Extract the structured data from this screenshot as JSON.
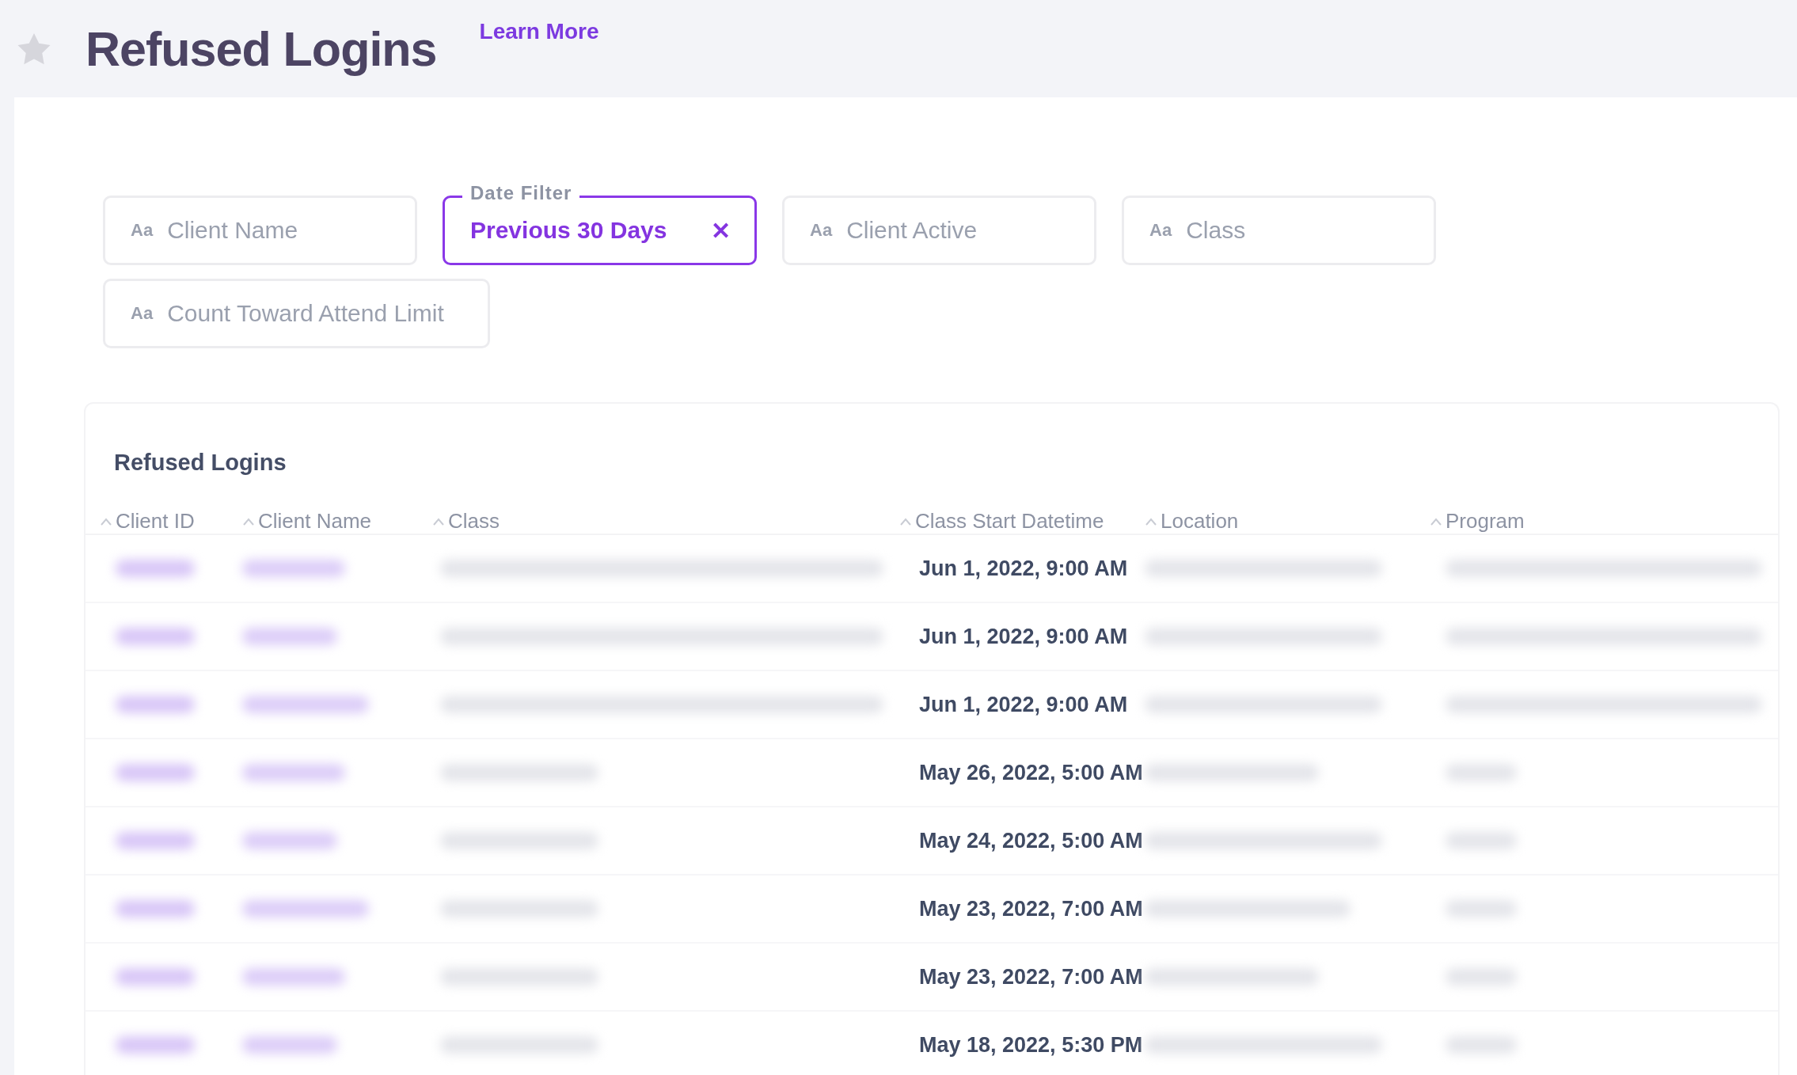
{
  "page": {
    "title": "Refused Logins",
    "favorite": false,
    "link": "Learn More"
  },
  "filters": [
    {
      "kind": "text",
      "type_icon": "Aa",
      "placeholder": "Client Name"
    },
    {
      "kind": "active",
      "label": "Date Filter",
      "value": "Previous 30 Days",
      "clear": "✕"
    },
    {
      "kind": "text",
      "type_icon": "Aa",
      "placeholder": "Client Active"
    },
    {
      "kind": "text",
      "type_icon": "Aa",
      "placeholder": "Class"
    },
    {
      "kind": "text",
      "type_icon": "Aa",
      "placeholder": "Count Toward Attend Limit"
    }
  ],
  "table": {
    "title": "Refused Logins",
    "columns": [
      "Client ID",
      "Client Name",
      "Class",
      "Class Start Datetime",
      "Location",
      "Program"
    ],
    "rows": [
      {
        "class_start": "Jun 1, 2022, 9:00 AM"
      },
      {
        "class_start": "Jun 1, 2022, 9:00 AM"
      },
      {
        "class_start": "Jun 1, 2022, 9:00 AM"
      },
      {
        "class_start": "May 26, 2022, 5:00 AM"
      },
      {
        "class_start": "May 24, 2022, 5:00 AM"
      },
      {
        "class_start": "May 23, 2022, 7:00 AM"
      },
      {
        "class_start": "May 23, 2022, 7:00 AM"
      },
      {
        "class_start": "May 18, 2022, 5:30 PM"
      }
    ]
  }
}
